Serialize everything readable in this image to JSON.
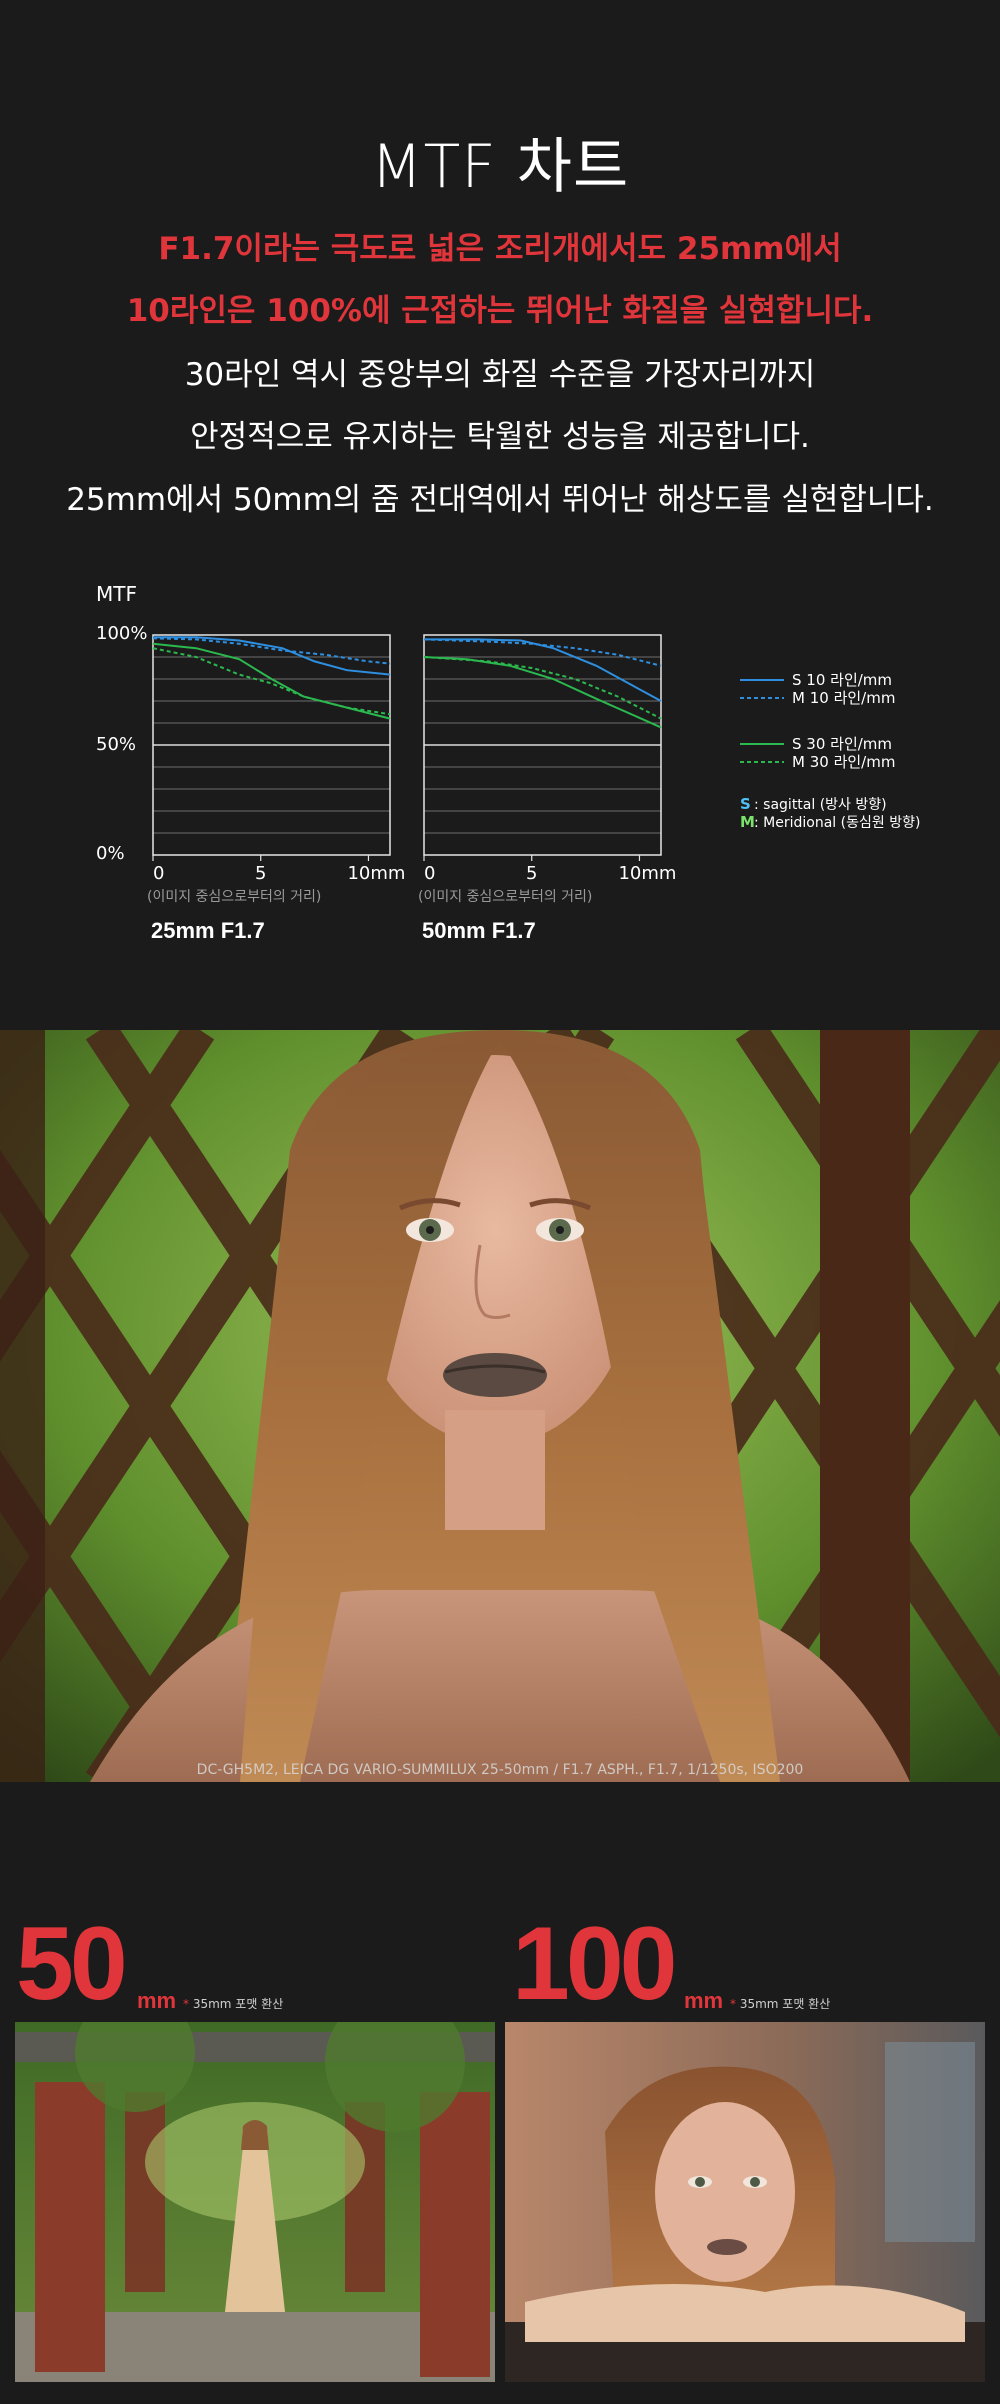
{
  "title": "MTF 차트",
  "lead": {
    "red_lines": [
      "F1.7이라는 극도로 넓은 조리개에서도 25mm에서",
      "10라인은 100%에 근접하는 뛰어난 화질을 실현합니다."
    ],
    "white_lines": [
      "30라인 역시 중앙부의 화질 수준을 가장자리까지",
      "안정적으로 유지하는 탁월한 성능을 제공합니다.",
      "25mm에서 50mm의 줌 전대역에서 뛰어난 해상도를 실현합니다."
    ]
  },
  "chart_data": {
    "type": "line",
    "ylabel": "MTF",
    "y_ticks": [
      "100%",
      "50%",
      "0%"
    ],
    "x_ticks": [
      "0",
      "5",
      "10mm"
    ],
    "xlabel": "(이미지 중심으로부터의 거리)",
    "ylim": [
      0,
      100
    ],
    "xlim": [
      0,
      11
    ],
    "grid": true,
    "legend_position": "right",
    "legend": [
      {
        "label": "S 10 라인/mm",
        "color": "#2e8fe0",
        "dash": false
      },
      {
        "label": "M 10 라인/mm",
        "color": "#2e8fe0",
        "dash": true
      },
      {
        "label": "S 30 라인/mm",
        "color": "#2bb84e",
        "dash": false
      },
      {
        "label": "M 30 라인/mm",
        "color": "#2bb84e",
        "dash": true
      }
    ],
    "legend_notes": [
      {
        "key": "S",
        "text": ": sagittal (방사 방향)",
        "color": "#4fc3f7"
      },
      {
        "key": "M",
        "text": ": Meridional (동심원 방향)",
        "color": "#7be36b"
      }
    ],
    "charts": [
      {
        "label": "25mm F1.7",
        "series": [
          {
            "name": "S 10 라인/mm",
            "color": "#2e8fe0",
            "dash": false,
            "points": [
              [
                0,
                99
              ],
              [
                2,
                99
              ],
              [
                4,
                97.5
              ],
              [
                6,
                94
              ],
              [
                7.5,
                88
              ],
              [
                9,
                84
              ],
              [
                11,
                82
              ]
            ]
          },
          {
            "name": "M 10 라인/mm",
            "color": "#2e8fe0",
            "dash": true,
            "points": [
              [
                0,
                98.5
              ],
              [
                2,
                98
              ],
              [
                4,
                96
              ],
              [
                6,
                93
              ],
              [
                8,
                91
              ],
              [
                10,
                88
              ],
              [
                11,
                87
              ]
            ]
          },
          {
            "name": "S 30 라인/mm",
            "color": "#2bb84e",
            "dash": false,
            "points": [
              [
                0,
                96
              ],
              [
                2,
                94
              ],
              [
                4,
                89
              ],
              [
                5.5,
                80
              ],
              [
                7,
                72
              ],
              [
                9,
                67
              ],
              [
                11,
                62
              ]
            ]
          },
          {
            "name": "M 30 라인/mm",
            "color": "#2bb84e",
            "dash": true,
            "points": [
              [
                0,
                94
              ],
              [
                2,
                90
              ],
              [
                4,
                82
              ],
              [
                5.5,
                78
              ],
              [
                7,
                72
              ],
              [
                9,
                67
              ],
              [
                11,
                64
              ]
            ]
          }
        ]
      },
      {
        "label": "50mm F1.7",
        "series": [
          {
            "name": "S 10 라인/mm",
            "color": "#2e8fe0",
            "dash": false,
            "points": [
              [
                0,
                98
              ],
              [
                2.5,
                98
              ],
              [
                4.5,
                97.5
              ],
              [
                6,
                94
              ],
              [
                8,
                86
              ],
              [
                11,
                70
              ]
            ]
          },
          {
            "name": "M 10 라인/mm",
            "color": "#2e8fe0",
            "dash": true,
            "points": [
              [
                0,
                98
              ],
              [
                3,
                97
              ],
              [
                5,
                96
              ],
              [
                7,
                94
              ],
              [
                9,
                91
              ],
              [
                11,
                86
              ]
            ]
          },
          {
            "name": "S 30 라인/mm",
            "color": "#2bb84e",
            "dash": false,
            "points": [
              [
                0,
                90
              ],
              [
                2,
                89
              ],
              [
                4,
                86
              ],
              [
                6,
                80
              ],
              [
                8,
                71
              ],
              [
                11,
                58
              ]
            ]
          },
          {
            "name": "M 30 라인/mm",
            "color": "#2bb84e",
            "dash": true,
            "points": [
              [
                0,
                90
              ],
              [
                3,
                88
              ],
              [
                5,
                85
              ],
              [
                7,
                80
              ],
              [
                9,
                72
              ],
              [
                11,
                62
              ]
            ]
          }
        ]
      }
    ]
  },
  "photo_caption": "DC-GH5M2, LEICA DG VARIO-SUMMILUX 25-50mm / F1.7 ASPH., F1.7, 1/1250s, ISO200",
  "focal": [
    {
      "number": "50",
      "unit": "mm",
      "star": "*",
      "note": "35mm 포맷 환산"
    },
    {
      "number": "100",
      "unit": "mm",
      "star": "*",
      "note": "35mm 포맷 환산"
    }
  ]
}
